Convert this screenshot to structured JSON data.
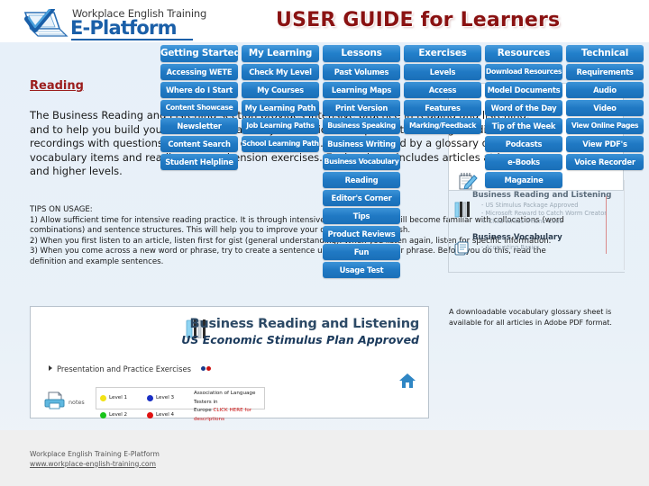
{
  "header": {
    "logo_line1": "Workplace English Training",
    "logo_line2": "E-Platform",
    "logo_icon": "laptop-checkmark-logo",
    "guide_title": "USER GUIDE for Learners",
    "title_color": "#8a1212"
  },
  "menu": {
    "accent_color": "#2079c4",
    "columns": [
      {
        "name": "getting-started",
        "heading": "Getting Started",
        "items": [
          "Accessing WETE",
          "Where do I Start",
          "Content Showcase",
          "Newsletter",
          "Content Search",
          "Student Helpline"
        ]
      },
      {
        "name": "my-learning",
        "heading": "My Learning",
        "items": [
          "Check My Level",
          "My Courses",
          "My Learning Path",
          "Job Learning Paths",
          "School Learning Path"
        ]
      },
      {
        "name": "lessons",
        "heading": "Lessons",
        "items": [
          "Past Volumes",
          "Learning Maps",
          "Print Version",
          "Business Speaking",
          "Business Writing",
          "Business Vocabulary",
          "Reading",
          "Editor's Corner",
          "Tips",
          "Product Reviews",
          "Fun",
          "Usage Test"
        ]
      },
      {
        "name": "exercises",
        "heading": "Exercises",
        "items": [
          "Levels",
          "Access",
          "Features",
          "Marking/Feedback"
        ]
      },
      {
        "name": "resources",
        "heading": "Resources",
        "items": [
          "Download Resources",
          "Model Documents",
          "Word of the Day",
          "Tip of the Week",
          "Podcasts",
          "e-Books",
          "Magazine"
        ]
      },
      {
        "name": "technical",
        "heading": "Technical",
        "items": [
          "Requirements",
          "Audio",
          "Video",
          "View Online Pages",
          "View PDF's",
          "Voice Recorder"
        ]
      }
    ]
  },
  "article": {
    "heading": "Reading",
    "paragraph": "The Business Reading and Listening section provides intensive practice in reading and listening, and to help you build your business vocabulary. The articles are presented through audio recordings with questions to check your comprehension. This is followed by a glossary of key vocabulary items and reading comprehension exercises. Each volume includes articles at lower and higher levels.",
    "tips_heading": "TIPS ON USAGE:",
    "tips": [
      "1) Allow sufficient time for intensive reading practice. It is through intensive reading that you will become familiar with collocations (word combinations) and sentence structures. This will help you to improve your overall level of English.",
      "2) When you first listen to an article, listen first for gist (general understanding). When you listen again, listen for specific information.",
      "3) When you come across a new word or phrase, try to create a sentence using the new word or phrase. Before you do this, read the definition and example sentences."
    ]
  },
  "right_panel": {
    "note": "A downloadable vocabulary glossary sheet is available for all articles in Adobe PDF format.",
    "sections": [
      {
        "title": "Business Reading and Listening",
        "icon": "books-icon",
        "items": [
          "- US Stimulus Package Approved",
          "- Microsoft Reward to Catch Worm Creator",
          "+ Child Writes iPhone Code"
        ]
      },
      {
        "title": "Business Vocabulary",
        "icon": "documents-icon",
        "items": [
          "- Accounting Basics"
        ]
      }
    ],
    "pencil_icon": "pencil-notepad-icon"
  },
  "screenshot": {
    "title": "Business Reading and Listening",
    "subtitle": "US Economic Stimulus Plan Approved",
    "bars_icon": "audio-bars-icon",
    "exercise_label": "Presentation and Practice Exercises",
    "exercise_dots": [
      "#1a3a8a",
      "#cc1111"
    ],
    "notes_label": "notes",
    "printer_icon": "printer-icon",
    "home_icon": "home-icon",
    "legend": {
      "levels": [
        {
          "label": "Level 1",
          "color": "#f2e215"
        },
        {
          "label": "Level 3",
          "color": "#1a2fc4"
        },
        {
          "label": "Level 2",
          "color": "#19c419"
        },
        {
          "label": "Level 4",
          "color": "#e01111"
        }
      ],
      "note_line1": "Association of Language Testers in",
      "note_line2_pre": "Europe ",
      "note_link": "CLICK HERE",
      "note_line2_post": " for descriptions"
    }
  },
  "footer": {
    "line1": "Workplace English Training E-Platform",
    "line2": "www.workplace-english-training.com"
  }
}
